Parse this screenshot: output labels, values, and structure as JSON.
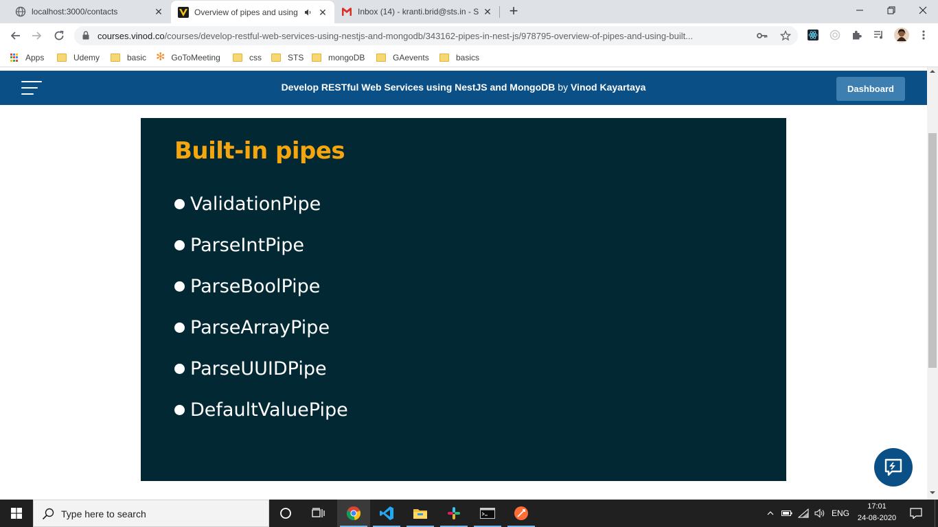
{
  "browser": {
    "tabs": [
      {
        "title": "localhost:3000/contacts",
        "favicon": "globe-icon"
      },
      {
        "title": "Overview of pipes and using",
        "favicon": "vinod-logo-icon",
        "active": true,
        "audio": true
      },
      {
        "title": "Inbox (14) - kranti.brid@sts.in - S",
        "favicon": "gmail-icon"
      }
    ],
    "url": {
      "domain": "courses.vinod.co",
      "path": "/courses/develop-restful-web-services-using-nestjs-and-mongodb/343162-pipes-in-nest-js/978795-overview-of-pipes-and-using-built..."
    },
    "bookmarks": [
      {
        "label": "Apps",
        "icon": "apps-grid-icon"
      },
      {
        "label": "Udemy",
        "icon": "folder-icon"
      },
      {
        "label": "basic",
        "icon": "folder-icon"
      },
      {
        "label": "GoToMeeting",
        "icon": "gotomeeting-icon"
      },
      {
        "label": "css",
        "icon": "folder-icon"
      },
      {
        "label": "STS",
        "icon": "folder-icon"
      },
      {
        "label": "mongoDB",
        "icon": "folder-icon"
      },
      {
        "label": "GAevents",
        "icon": "folder-icon"
      },
      {
        "label": "basics",
        "icon": "folder-icon"
      }
    ]
  },
  "site": {
    "course_title": "Develop RESTful Web Services using NestJS and MongoDB",
    "by": "by",
    "author": "Vinod Kayartaya",
    "dashboard_label": "Dashboard",
    "brand_color": "#0a4f86"
  },
  "slide": {
    "title": "Built-in pipes",
    "items": [
      "ValidationPipe",
      "ParseIntPipe",
      "ParseBoolPipe",
      "ParseArrayPipe",
      "ParseUUIDPipe",
      "DefaultValuePipe"
    ],
    "background": "#022933",
    "title_color": "#f5a60e"
  },
  "taskbar": {
    "search_placeholder": "Type here to search",
    "language": "ENG",
    "time": "17:01",
    "date": "24-08-2020"
  }
}
